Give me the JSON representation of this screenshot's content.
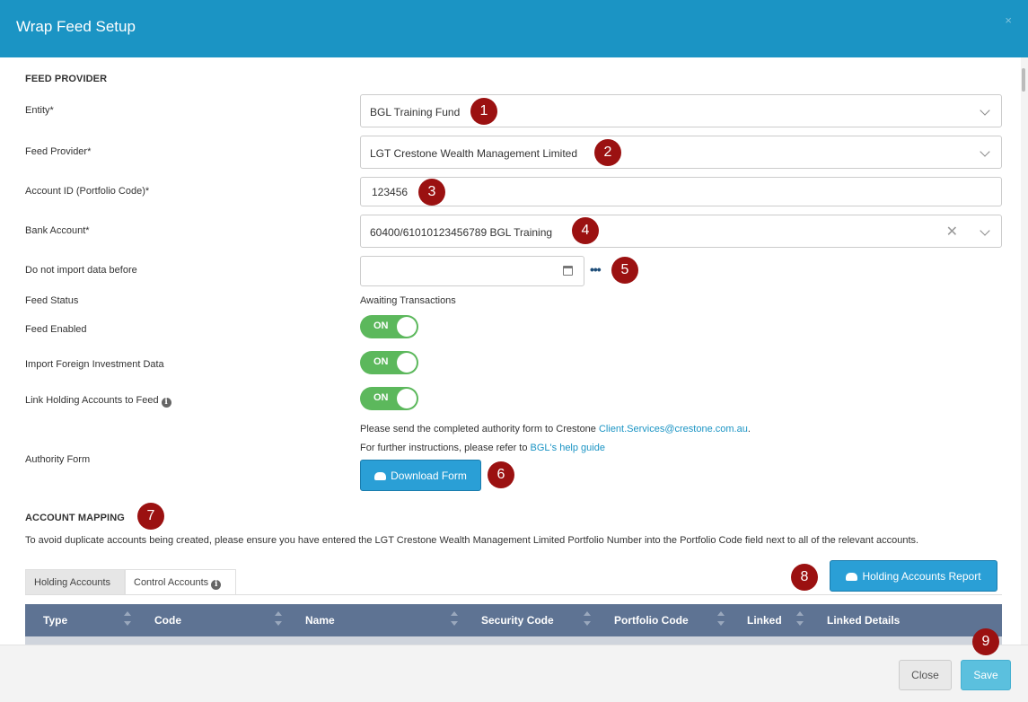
{
  "header": {
    "title": "Wrap Feed Setup",
    "close_glyph": "×"
  },
  "feed_provider": {
    "section_title": "FEED PROVIDER",
    "entity": {
      "label": "Entity*",
      "value": "BGL Training Fund"
    },
    "provider": {
      "label": "Feed Provider*",
      "value": "LGT Crestone Wealth Management Limited"
    },
    "account_id": {
      "label": "Account ID (Portfolio Code)*",
      "value": "123456"
    },
    "bank_account": {
      "label": "Bank Account*",
      "value": "60400/61010123456789 BGL Training"
    },
    "import_before": {
      "label": "Do not import data before",
      "value": "",
      "more": "•••"
    },
    "feed_status": {
      "label": "Feed Status",
      "value": "Awaiting Transactions"
    },
    "feed_enabled": {
      "label": "Feed Enabled",
      "state": "ON"
    },
    "import_foreign": {
      "label": "Import Foreign Investment Data",
      "state": "ON"
    },
    "link_holding": {
      "label": "Link Holding Accounts to Feed",
      "state": "ON",
      "info": "i"
    },
    "authority": {
      "label": "Authority Form",
      "line1_text": "Please send the completed authority form to Crestone ",
      "line1_link": "Client.Services@crestone.com.au",
      "line1_end": ".",
      "line2_text": "For further instructions, please refer to ",
      "line2_link": "BGL's help guide",
      "download_label": "Download Form"
    }
  },
  "account_mapping": {
    "section_title": "ACCOUNT MAPPING",
    "description": "To avoid duplicate accounts being created, please ensure you have entered the LGT Crestone Wealth Management Limited Portfolio Number into the Portfolio Code field next to all of the relevant accounts.",
    "tabs": [
      {
        "label": "Holding Accounts",
        "active": true
      },
      {
        "label": "Control Accounts",
        "active": false
      }
    ],
    "tab_info": "i",
    "report_button": "Holding Accounts Report",
    "columns": [
      "Type",
      "Code",
      "Name",
      "Security Code",
      "Portfolio Code",
      "Linked",
      "Linked Details"
    ]
  },
  "callouts": [
    "1",
    "2",
    "3",
    "4",
    "5",
    "6",
    "7",
    "8",
    "9"
  ],
  "footer": {
    "close_label": "Close",
    "save_label": "Save"
  },
  "colors": {
    "header": "#1b94c4",
    "toggle_on": "#5cb85c",
    "callout": "#9b1111",
    "grid_header": "#5e7393",
    "save": "#5bc0de"
  }
}
